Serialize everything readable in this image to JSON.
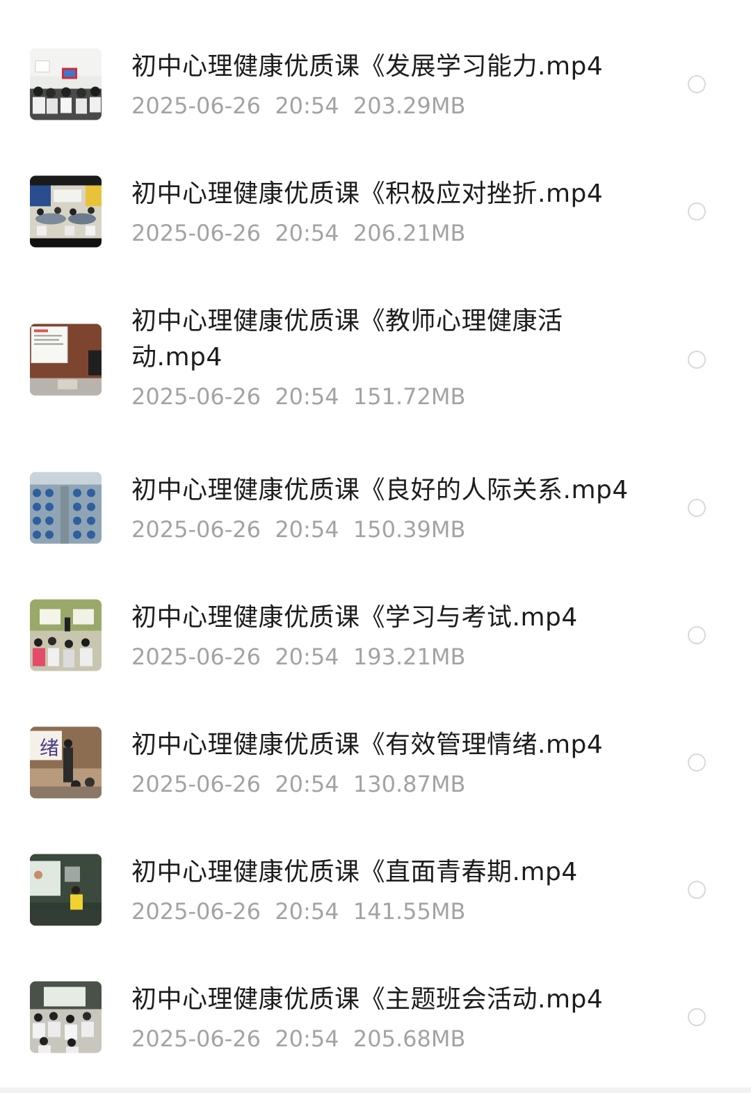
{
  "files": [
    {
      "name": "初中心理健康优质课《发展学习能力.mp4",
      "date": "2025-06-26",
      "time": "20:54",
      "size": "203.29MB",
      "thumbnail": "classroom-projector-thumbnail"
    },
    {
      "name": "初中心理健康优质课《积极应对挫折.mp4",
      "date": "2025-06-26",
      "time": "20:54",
      "size": "206.21MB",
      "thumbnail": "classroom-group-desks-thumbnail"
    },
    {
      "name": "初中心理健康优质课《教师心理健康活动.mp4",
      "date": "2025-06-26",
      "time": "20:54",
      "size": "151.72MB",
      "thumbnail": "classroom-whiteboard-thumbnail"
    },
    {
      "name": "初中心理健康优质课《良好的人际关系.mp4",
      "date": "2025-06-26",
      "time": "20:54",
      "size": "150.39MB",
      "thumbnail": "students-blue-uniform-thumbnail"
    },
    {
      "name": "初中心理健康优质课《学习与考试.mp4",
      "date": "2025-06-26",
      "time": "20:54",
      "size": "193.21MB",
      "thumbnail": "classroom-students-thumbnail"
    },
    {
      "name": "初中心理健康优质课《有效管理情绪.mp4",
      "date": "2025-06-26",
      "time": "20:54",
      "size": "130.87MB",
      "thumbnail": "teacher-emotion-slide-thumbnail"
    },
    {
      "name": "初中心理健康优质课《直面青春期.mp4",
      "date": "2025-06-26",
      "time": "20:54",
      "size": "141.55MB",
      "thumbnail": "teacher-yellow-blackboard-thumbnail"
    },
    {
      "name": "初中心理健康优质课《主题班会活动.mp4",
      "date": "2025-06-26",
      "time": "20:54",
      "size": "205.68MB",
      "thumbnail": "classroom-students-white-thumbnail"
    }
  ],
  "thumbnail_text": {
    "emotion_slide": "绪"
  },
  "colors": {
    "title": "#1c1c1c",
    "meta": "#a3a3a3",
    "radio_border": "#d9d9d9",
    "background": "#ffffff"
  }
}
